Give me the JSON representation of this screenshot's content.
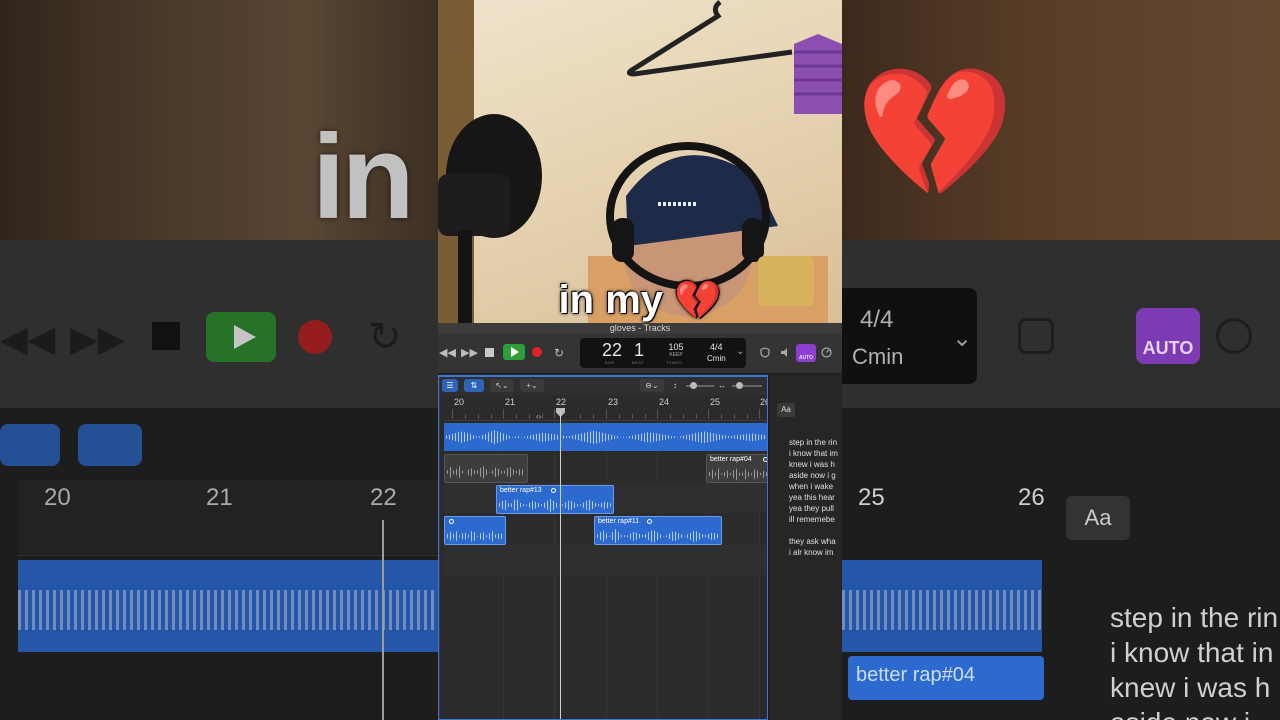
{
  "caption": {
    "text": "in my",
    "emoji": "💔"
  },
  "window": {
    "title": "gloves - Tracks"
  },
  "transport": {
    "rewind_icon": "rewind-icon",
    "forward_icon": "fast-forward-icon",
    "stop_icon": "stop-icon",
    "play_icon": "play-icon",
    "record_icon": "record-icon",
    "cycle_icon": "cycle-icon"
  },
  "lcd": {
    "bar": "22",
    "beat": "1",
    "bar_label": "BAR",
    "beat_label": "BEAT",
    "tempo": "105",
    "tempo_mode": "KEEP",
    "tempo_label": "TEMPO",
    "time_signature": "4/4",
    "key": "Cmin"
  },
  "control_right": {
    "auto_label": "AUTO"
  },
  "ruler": {
    "bars": [
      "20",
      "21",
      "22",
      "23",
      "24",
      "25",
      "26"
    ]
  },
  "regions": [
    {
      "name": "better rap#04"
    },
    {
      "name": "better rap#13"
    },
    {
      "name": "better rap#11"
    }
  ],
  "side_panel": {
    "aa_label": "Aa",
    "lyrics": [
      "step in the rin",
      "i know that im",
      "knew i was h",
      "aside now i g",
      "when i wake",
      "yea this hear",
      "yea they pull",
      "ill rememebe",
      "",
      "they ask wha",
      "i alr know im"
    ]
  },
  "background": {
    "big_text": "in",
    "lcd_sig": "4/4",
    "lcd_key": "Cmin",
    "auto_label": "AUTO",
    "ruler_bars_left": [
      "20",
      "21",
      "22"
    ],
    "ruler_bars_right": [
      "25",
      "26"
    ],
    "aa_label": "Aa",
    "region_name": "better rap#04",
    "lyrics": [
      "step in the rin",
      "i know that in",
      "knew i was h",
      "aside now i"
    ]
  },
  "colors": {
    "play": "#2f9e37",
    "record": "#e0242a",
    "region": "#2d6ad0",
    "auto": "#8c3fd0",
    "accent": "#3a76d6"
  }
}
